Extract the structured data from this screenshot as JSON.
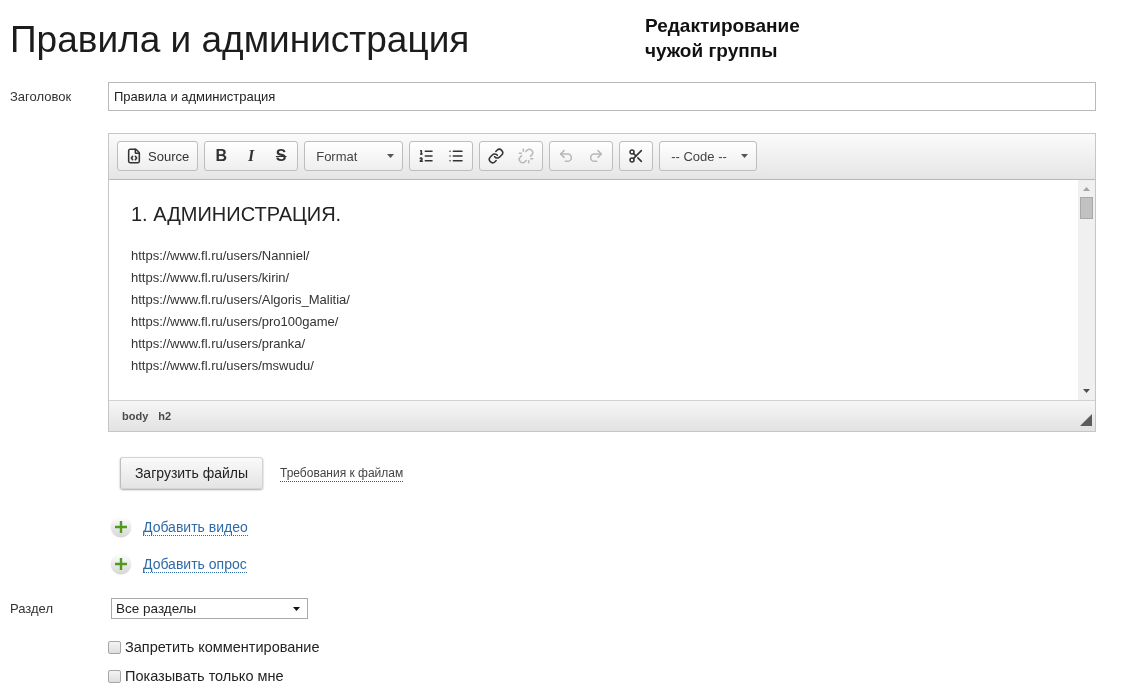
{
  "page": {
    "title": "Правила и администрация",
    "subtitle": "Редактирование чужой группы"
  },
  "title_field": {
    "label": "Заголовок",
    "value": "Правила и администрация"
  },
  "editor": {
    "toolbar": [
      {
        "kind": "buttons",
        "buttons": [
          {
            "label": "Source",
            "disabled": false
          }
        ]
      },
      {
        "kind": "buttons",
        "buttons": [
          {
            "label": "B",
            "disabled": false
          },
          {
            "label": "I",
            "disabled": false
          },
          {
            "label": "S",
            "disabled": false
          }
        ]
      },
      {
        "kind": "combo",
        "label": "Format"
      },
      {
        "kind": "buttons",
        "buttons": [
          {
            "disabled": false
          },
          {
            "disabled": false
          }
        ]
      },
      {
        "kind": "buttons",
        "buttons": [
          {
            "disabled": false
          },
          {
            "disabled": true
          }
        ]
      },
      {
        "kind": "buttons",
        "buttons": [
          {
            "disabled": true
          },
          {
            "disabled": true
          }
        ]
      },
      {
        "kind": "buttons",
        "buttons": [
          {
            "disabled": false
          }
        ]
      },
      {
        "kind": "combo",
        "label": "-- Code --"
      }
    ],
    "content": {
      "heading": "1. АДМИНИСТРАЦИЯ.",
      "lines": [
        "https://www.fl.ru/users/Nanniel/",
        "https://www.fl.ru/users/kirin/",
        "https://www.fl.ru/users/Algoris_Malitia/",
        "https://www.fl.ru/users/pro100game/",
        "https://www.fl.ru/users/pranka/",
        "https://www.fl.ru/users/mswudu/"
      ]
    },
    "path": [
      "body",
      "h2"
    ]
  },
  "attachments": {
    "upload_button": "Загрузить файлы",
    "requirements_link": "Требования к файлам"
  },
  "add_links": [
    "Добавить видео",
    "Добавить опрос"
  ],
  "section": {
    "label": "Раздел",
    "value": "Все разделы"
  },
  "options": [
    {
      "label": "Запретить комментирование",
      "checked": false
    },
    {
      "label": "Показывать только мне",
      "checked": false
    }
  ]
}
